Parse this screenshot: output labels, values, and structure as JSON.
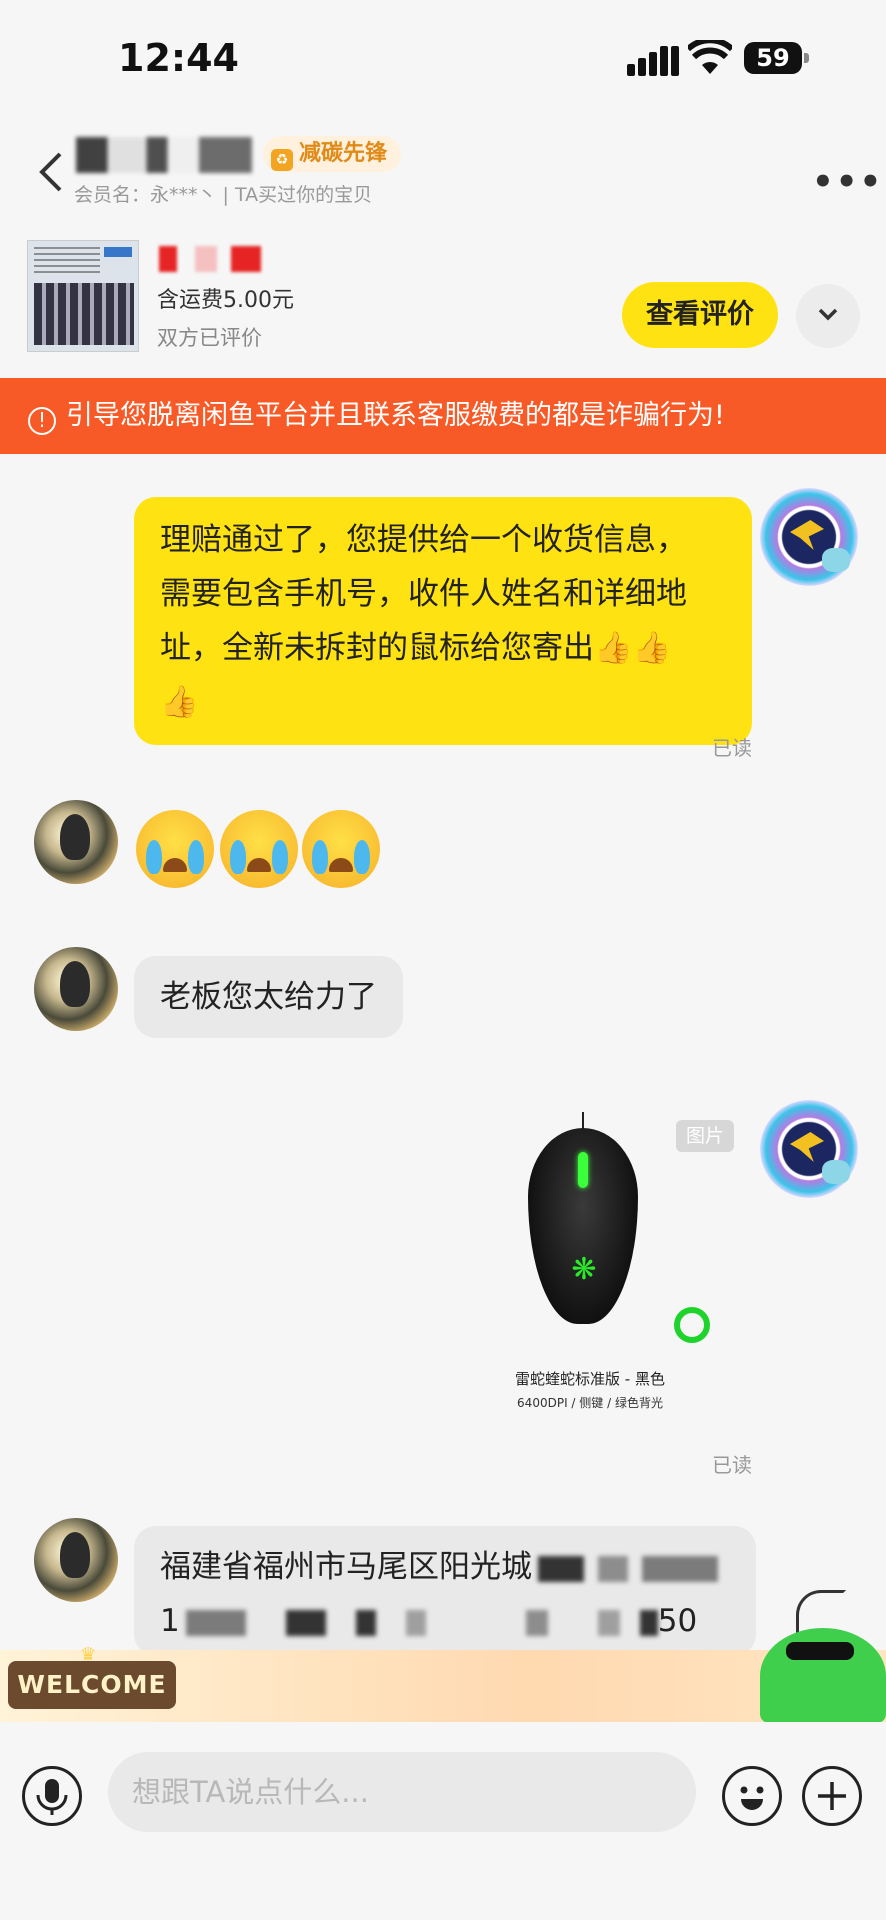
{
  "status_bar": {
    "time": "12:44",
    "battery": "59"
  },
  "header": {
    "badge": "减碳先锋",
    "member": "会员名：永***丶 | TA买过你的宝贝",
    "more": "•••"
  },
  "product": {
    "shipping": "含运费5.00元",
    "rated": "双方已评价",
    "review_button": "查看评价"
  },
  "warning": {
    "text": "引导您脱离闲鱼平台并且联系客服缴费的都是诈骗行为!"
  },
  "messages": {
    "m1_lines": [
      "理赔通过了，您提供给一个收货信息，",
      "需要包含手机号，收件人姓名和详细地",
      "址，全新未拆封的鼠标给您寄出👍👍",
      "👍"
    ],
    "read": "已读",
    "m3": "老板您太给力了",
    "image_tag": "图片",
    "mouse_name": "雷蛇蝰蛇标准版 - 黑色",
    "mouse_spec": "6400DPI / 侧键 / 绿色背光",
    "addr_line1": "福建省福州市马尾区阳光城",
    "addr_line2_start": "1",
    "addr_line2_end": "50"
  },
  "banner": {
    "welcome": "WELCOME"
  },
  "input": {
    "placeholder": "想跟TA说点什么..."
  }
}
